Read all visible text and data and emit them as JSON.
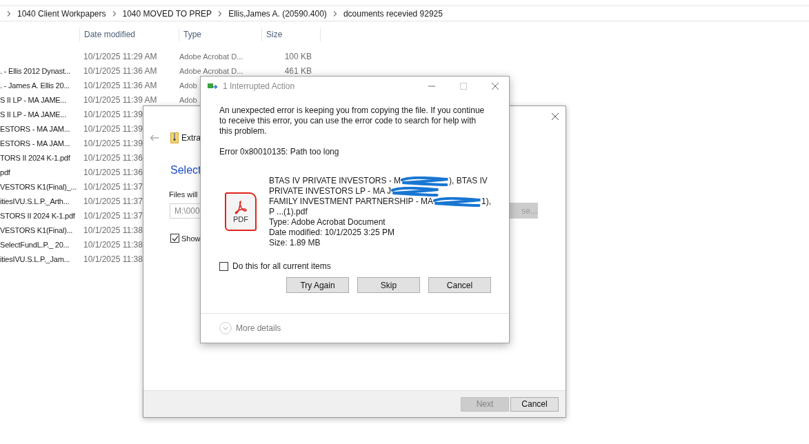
{
  "breadcrumb": [
    "1040 Client Workpapers",
    "1040 MOVED TO PREP",
    "Ellis,James A. (20590.400)",
    "dcouments recevied 92925"
  ],
  "columns": [
    "Date modified",
    "Type",
    "Size"
  ],
  "files": [
    {
      "date": "10/1/2025 11:29 AM",
      "type": "Adobe Acrobat D...",
      "size": "100 KB"
    },
    {
      "name": ". - Ellis 2012 Dynast...",
      "date": "10/1/2025 11:36 AM",
      "type": "Adobe Acrobat D...",
      "size": "461 KB"
    },
    {
      "name": ". - James A. Ellis 20...",
      "date": "10/1/2025 11:36 AM",
      "type": "Adob"
    },
    {
      "name": "S II LP - MA JAME...",
      "date": "10/1/2025 11:39 AM",
      "type": "Adob"
    },
    {
      "name": "S II LP - MA JAME...",
      "date": "10/1/2025 11:39"
    },
    {
      "name": "ESTORS - MA JAM...",
      "date": "10/1/2025 11:39"
    },
    {
      "name": "ESTORS - MA JAM...",
      "date": "10/1/2025 11:39"
    },
    {
      "name": "TORS II 2024 K-1.pdf",
      "date": "10/1/2025 11:36"
    },
    {
      "name": "pdf",
      "date": "10/1/2025 11:36"
    },
    {
      "name": "VESTORS K1(Final)_...",
      "date": "10/1/2025 11:37"
    },
    {
      "name": "itiesIVU.S.L.P._Arth...",
      "date": "10/1/2025 11:37"
    },
    {
      "name": "STORS II 2024 K-1.pdf",
      "date": "10/1/2025 11:37"
    },
    {
      "name": "VESTORS K1(Final)...",
      "date": "10/1/2025 11:38"
    },
    {
      "name": "SelectFundL.P._ 20...",
      "date": "10/1/2025 11:38"
    },
    {
      "name": "itiesIVU.S.L.P._Jam...",
      "date": "10/1/2025 11:38"
    }
  ],
  "wizard": {
    "title": "Extra",
    "heading": "Select",
    "label": "Files will",
    "path_value": "M:\\000",
    "browse": {
      "label": "se...",
      "disabled": true
    },
    "show": {
      "label": "Show",
      "checked": true
    },
    "buttons": [
      {
        "label": "Next",
        "disabled": true
      },
      {
        "label": "Cancel",
        "disabled": false
      }
    ]
  },
  "dialog": {
    "title": "1 Interrupted Action",
    "maximize_disabled": true,
    "message": "An unexpected error is keeping you from copying the file. If you continue to receive this error, you can use the error code to search for help with this problem.",
    "error": "Error 0x80010135: Path too long",
    "file_icon_label": "PDF",
    "name_lines": [
      [
        {
          "kind": "text",
          "text": "BTAS IV PRIVATE INVESTORS - M"
        },
        {
          "kind": "redacted"
        },
        {
          "kind": "text",
          "text": "), BTAS IV"
        }
      ],
      [
        {
          "kind": "text",
          "text": "PRIVATE INVESTORS LP - MA J"
        },
        {
          "kind": "redacted"
        }
      ],
      [
        {
          "kind": "text",
          "text": "FAMILY INVESTMENT PARTNERSHIP - MA"
        },
        {
          "kind": "redacted"
        },
        {
          "kind": "text",
          "text": "1),"
        }
      ],
      [
        {
          "kind": "text",
          "text": "P ...(1).pdf"
        }
      ]
    ],
    "details": [
      "Type: Adobe Acrobat Document",
      "Date modified: 10/1/2025 3:25 PM",
      "Size: 1.89 MB"
    ],
    "apply_all": {
      "label": "Do this for all current items",
      "checked": false
    },
    "buttons": [
      "Try Again",
      "Skip",
      "Cancel"
    ],
    "more_details": "More details"
  }
}
